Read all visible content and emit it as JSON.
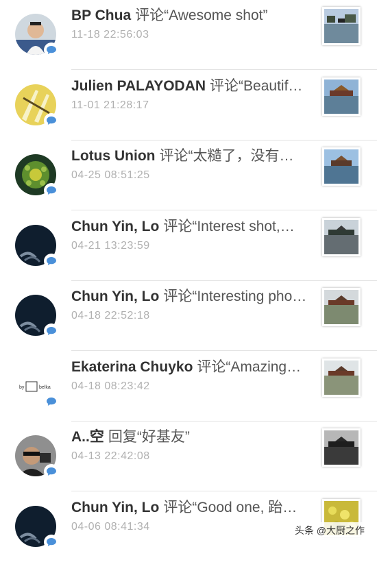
{
  "notifications": [
    {
      "name": "BP Chua",
      "action": "评论",
      "comment": "“Awesome shot”",
      "time": "11-18 22:56:03"
    },
    {
      "name": "Julien PALAYODAN",
      "action": "评论",
      "comment": "“Beautif…",
      "time": "11-01 21:28:17"
    },
    {
      "name": "Lotus Union",
      "action": "评论",
      "comment": "“太糙了，没有…",
      "time": "04-25 08:51:25"
    },
    {
      "name": "Chun Yin, Lo",
      "action": "评论",
      "comment": "“Interest shot,…",
      "time": "04-21 13:23:59"
    },
    {
      "name": "Chun Yin, Lo",
      "action": "评论",
      "comment": "“Interesting pho…",
      "time": "04-18 22:52:18"
    },
    {
      "name": "Ekaterina Chuyko",
      "action": "评论",
      "comment": "“Amazing…",
      "time": "04-18 08:23:42",
      "avatar_text": {
        "left": "by",
        "right": "belka"
      }
    },
    {
      "name": "A..空",
      "action": "回复",
      "comment": "“好基友”",
      "time": "04-13 22:42:08"
    },
    {
      "name": "Chun Yin, Lo",
      "action": "评论",
      "comment": "“Good one, 跆…",
      "time": "04-06 08:41:34"
    }
  ],
  "watermark": "头条 @大厨之作",
  "colors": {
    "badge": "#4a90d9",
    "name": "#333333",
    "time": "#b0b0b0",
    "divider": "#e3e3e3"
  }
}
